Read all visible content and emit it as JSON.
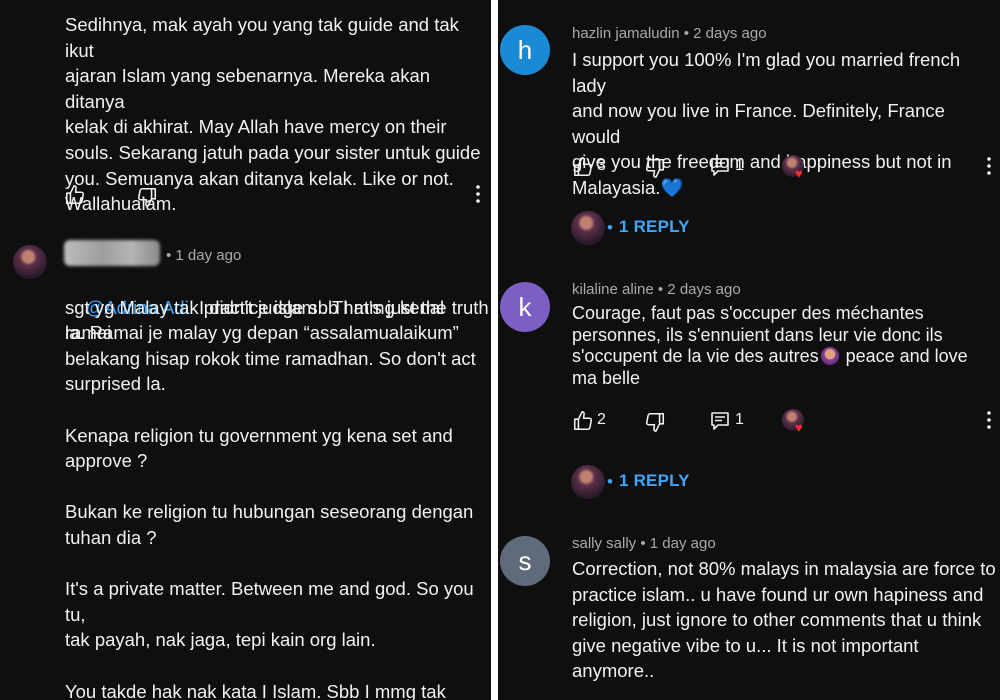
{
  "left": {
    "comment1": {
      "text": "Sedihnya, mak ayah you yang tak guide and tak ikut\najaran Islam yang sebenarnya. Mereka akan ditanya\nkelak di akhirat. May Allah have mercy on their\nsouls. Sekarang jatuh pada your sister untuk guide\nyou. Semuanya akan ditanya kelak. Like or not.\nWallahualam."
    },
    "comment2": {
      "time": "• 1 day ago",
      "mention": "@Adrina Adi",
      "first_line_rest": "  I didn't judge sbb I mmg kenal ramai",
      "text": "sgt yg Malay tak practice islam . That's just the truth\nla. Ramai je malay yg depan “assalamualaikum”\nbelakang hisap rokok time ramadhan. So don't act\nsurprised la.\n\nKenapa religion tu government yg kena set and\napprove ?\n\nBukan ke religion tu hubungan seseorang dengan\ntuhan dia ?\n\nIt's a private matter. Between me and god. So you tu,\ntak payah, nak jaga, tepi kain org lain.\n\nYou takde hak nak kata I Islam. Sbb I mmg tak\npercaya dalam islam. So, let me be. Thanks."
    }
  },
  "right": {
    "comments": [
      {
        "avatar_letter": "h",
        "avatar_color": "#1a8ad4",
        "author": "hazlin jamaludin",
        "time": "• 2 days ago",
        "text": "I support you 100% I'm glad you married french lady\nand now you live in France. Definitely, France would\ngive you the freedom and happiness but not in\nMalayasia.",
        "emoji": "💙",
        "likes": "3",
        "replies_count": "1",
        "reply_link": "1 REPLY"
      },
      {
        "avatar_letter": "k",
        "avatar_color": "#7b5fc4",
        "author": "kilaline aline",
        "time": "• 2 days ago",
        "text_line1": "Courage, faut pas s'occuper des méchantes",
        "text_line2": "personnes, ils s'ennuient dans leur vie donc ils",
        "text_line3a": "s'occupent de la vie des autres",
        "text_line3b": " peace and love",
        "text_line4": "ma belle",
        "likes": "2",
        "replies_count": "1",
        "reply_link": "1 REPLY"
      },
      {
        "avatar_letter": "s",
        "avatar_color": "#5f6b7a",
        "author": "sally sally",
        "time": "• 1 day ago",
        "text": "Correction, not 80% malays in malaysia are force to\npractice islam.. u have found ur own hapiness and\nreligion, just ignore to other comments that u think\ngive negative vibe to u... It is not important\nanymore.."
      }
    ]
  }
}
